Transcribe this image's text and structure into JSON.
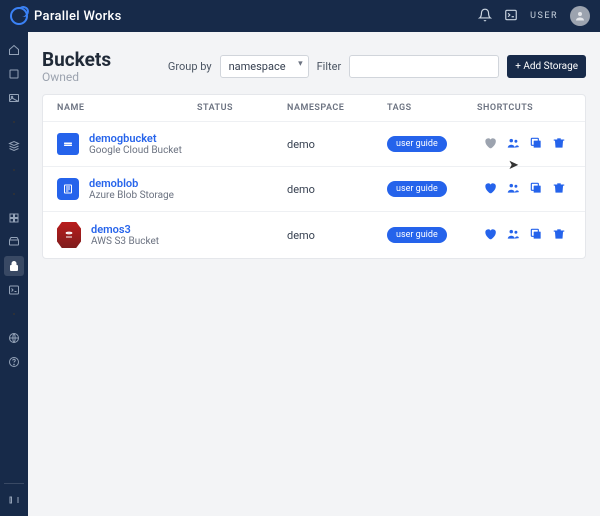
{
  "brand": "Parallel Works",
  "user_label": "USER",
  "page": {
    "title": "Buckets",
    "subtitle": "Owned",
    "group_by_label": "Group by",
    "group_by_value": "namespace",
    "filter_label": "Filter",
    "filter_value": "",
    "add_button": "+ Add Storage"
  },
  "columns": {
    "name": "NAME",
    "status": "STATUS",
    "namespace": "NAMESPACE",
    "tags": "TAGS",
    "shortcuts": "SHORTCUTS"
  },
  "rows": [
    {
      "name": "demogbucket",
      "provider": "Google Cloud Bucket",
      "provider_kind": "gcs",
      "namespace": "demo",
      "tag": "user guide",
      "favorited": "muted"
    },
    {
      "name": "demoblob",
      "provider": "Azure Blob Storage",
      "provider_kind": "azure",
      "namespace": "demo",
      "tag": "user guide",
      "favorited": ""
    },
    {
      "name": "demos3",
      "provider": "AWS S3 Bucket",
      "provider_kind": "aws",
      "namespace": "demo",
      "tag": "user guide",
      "favorited": ""
    }
  ],
  "sidebar_icons": [
    "home",
    "box",
    "image",
    "dot",
    "stack",
    "dot",
    "dot",
    "grid",
    "drive",
    "lock",
    "terminal",
    "dot",
    "globe",
    "help"
  ],
  "sidebar_active_index": 9
}
